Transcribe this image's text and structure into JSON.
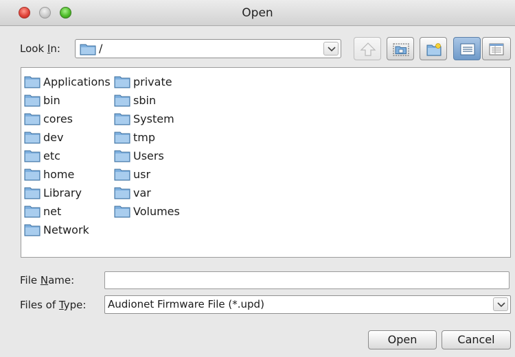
{
  "window": {
    "title": "Open"
  },
  "look_in": {
    "label_prefix": "Look ",
    "label_underline": "I",
    "label_suffix": "n:",
    "value": "/"
  },
  "toolbar": {
    "buttons": [
      {
        "name": "up-one-level-icon",
        "state": "disabled"
      },
      {
        "name": "home-icon",
        "state": "normal"
      },
      {
        "name": "new-folder-icon",
        "state": "normal"
      },
      {
        "name": "list-view-icon",
        "state": "active"
      },
      {
        "name": "details-view-icon",
        "state": "normal"
      }
    ]
  },
  "files": {
    "column1": [
      "Applications",
      "bin",
      "cores",
      "dev",
      "etc",
      "home",
      "Library",
      "net",
      "Network"
    ],
    "column2": [
      "private",
      "sbin",
      "System",
      "tmp",
      "Users",
      "usr",
      "var",
      "Volumes"
    ]
  },
  "file_name": {
    "label_prefix": "File ",
    "label_underline": "N",
    "label_suffix": "ame:",
    "value": ""
  },
  "file_type": {
    "label_prefix": "Files of ",
    "label_underline": "T",
    "label_suffix": "ype:",
    "value": "Audionet Firmware File (*.upd)"
  },
  "buttons": {
    "open": "Open",
    "cancel": "Cancel"
  },
  "colors": {
    "folder": "#5b9bd5",
    "active_view": "#7aa3d1"
  }
}
